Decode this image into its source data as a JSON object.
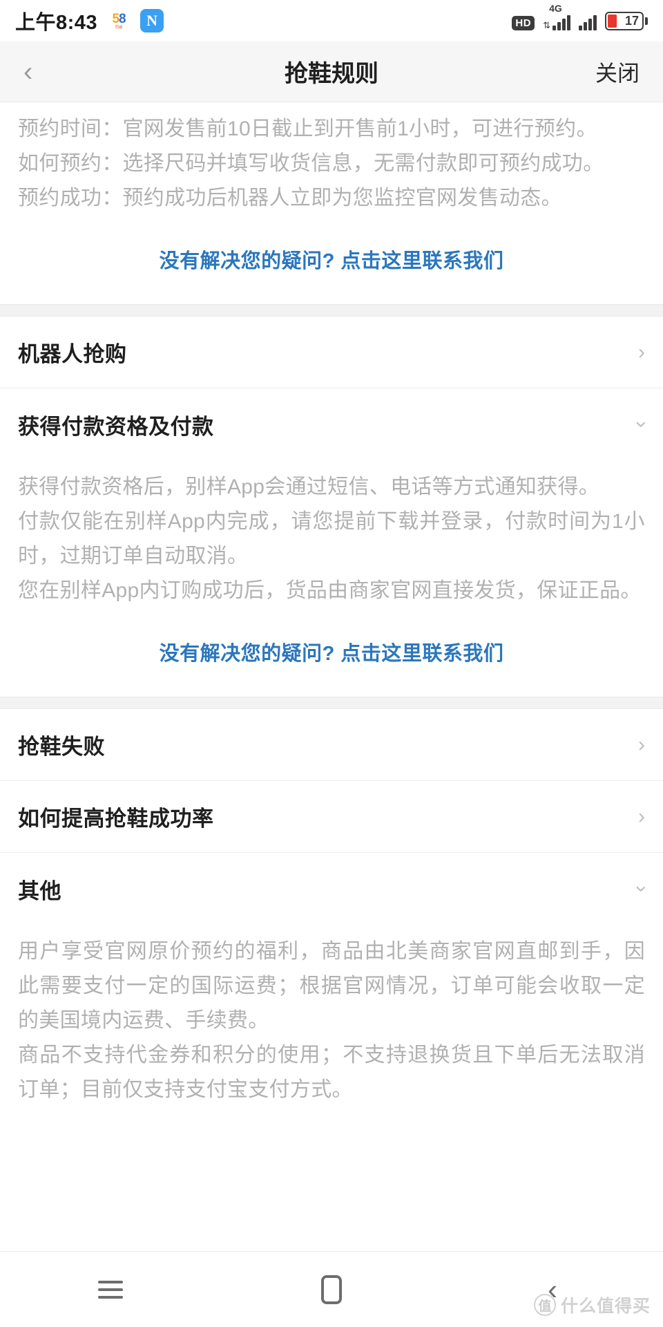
{
  "status_bar": {
    "time": "上午8:43",
    "app_icon_58_top": "58",
    "app_icon_58_sub": "同城",
    "app_icon_n": "N",
    "hd_label": "HD",
    "network_type": "4G",
    "battery_percent": "17"
  },
  "header": {
    "back_icon": "‹",
    "title": "抢鞋规则",
    "close_label": "关闭"
  },
  "sections": {
    "reservation": {
      "paragraphs": [
        "预约时间：官网发售前10日截止到开售前1小时，可进行预约。",
        "如何预约：选择尺码并填写收货信息，无需付款即可预约成功。",
        "预约成功：预约成功后机器人立即为您监控官网发售动态。"
      ],
      "contact_link": "没有解决您的疑问? 点击这里联系我们"
    },
    "robot_purchase": {
      "title": "机器人抢购",
      "expanded": false,
      "chevron": "›"
    },
    "payment": {
      "title": "获得付款资格及付款",
      "expanded": true,
      "chevron": "›",
      "paragraphs": [
        "获得付款资格后，别样App会通过短信、电话等方式通知获得。",
        "付款仅能在别样App内完成，请您提前下载并登录，付款时间为1小时，过期订单自动取消。",
        "您在别样App内订购成功后，货品由商家官网直接发货，保证正品。"
      ],
      "contact_link": "没有解决您的疑问? 点击这里联系我们"
    },
    "grab_failed": {
      "title": "抢鞋失败",
      "expanded": false,
      "chevron": "›"
    },
    "improve_rate": {
      "title": "如何提高抢鞋成功率",
      "expanded": false,
      "chevron": "›"
    },
    "other": {
      "title": "其他",
      "expanded": true,
      "chevron": "›",
      "paragraphs": [
        "用户享受官网原价预约的福利，商品由北美商家官网直邮到手，因此需要支付一定的国际运费；根据官网情况，订单可能会收取一定的美国境内运费、手续费。",
        "商品不支持代金券和积分的使用；不支持退换货且下单后无法取消订单；目前仅支持支付宝支付方式。"
      ]
    }
  },
  "nav_bar": {
    "menu_label": "菜单",
    "home_label": "主页",
    "back_label": "返回"
  },
  "watermark": {
    "logo_char": "值",
    "text": "什么值得买"
  },
  "colors": {
    "link_blue": "#2b77bd",
    "body_gray": "#b1b1b1",
    "title_dark": "#1f1f1f",
    "header_bg": "#f6f6f6",
    "battery_red": "#e8372c"
  }
}
